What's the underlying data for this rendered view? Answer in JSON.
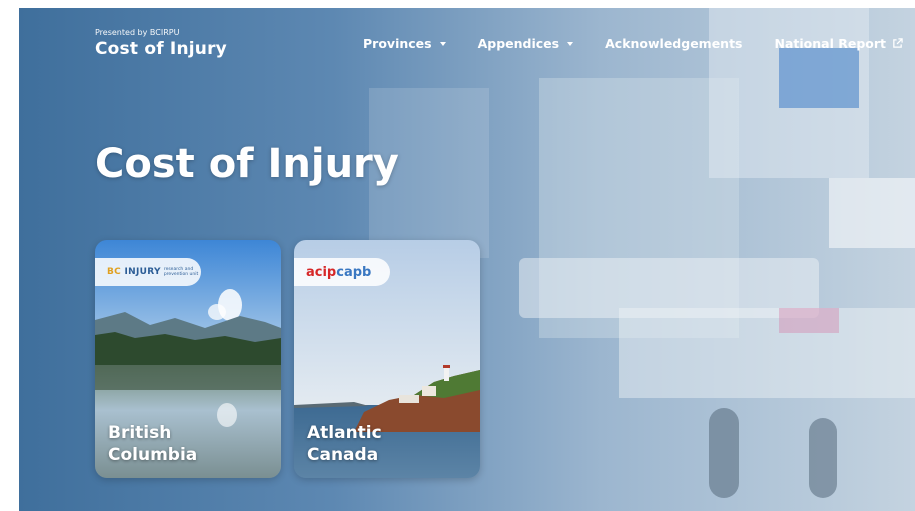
{
  "brand": {
    "presented_by": "Presented by BCIRPU",
    "title": "Cost of Injury"
  },
  "nav": {
    "items": [
      {
        "label": "Provinces",
        "dropdown": true
      },
      {
        "label": "Appendices",
        "dropdown": true
      },
      {
        "label": "Acknowledgements",
        "dropdown": false
      },
      {
        "label": "National Report",
        "external": true
      }
    ]
  },
  "hero": {
    "title": "Cost of Injury"
  },
  "cards": [
    {
      "label_line1": "British",
      "label_line2": "Columbia",
      "logo_main_prefix": "BC",
      "logo_main_rest": " INJURY",
      "logo_small_line1": "research and",
      "logo_small_line2": "prevention unit"
    },
    {
      "label_line1": "Atlantic",
      "label_line2": "Canada",
      "logo_red": "acip",
      "logo_blue": "capb"
    }
  ]
}
